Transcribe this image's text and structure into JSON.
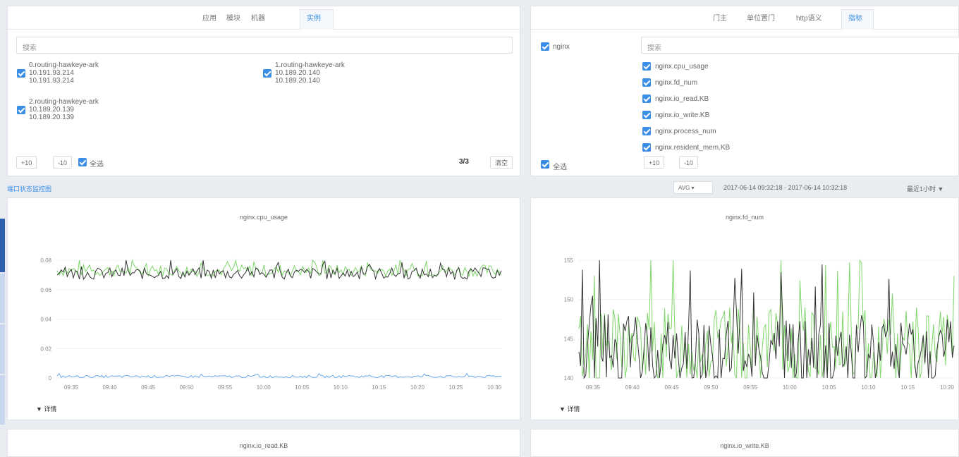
{
  "left_panel": {
    "tabs": [
      "应用",
      "模块",
      "机器",
      "实例"
    ],
    "active_tab": 3,
    "search_placeholder": "搜索",
    "instances": [
      {
        "name": "0.routing-hawkeye-ark",
        "ip1": "10.191.93.214",
        "ip2": "10.191.93.214"
      },
      {
        "name": "1.routing-hawkeye-ark",
        "ip1": "10.189.20.140",
        "ip2": "10.189.20.140"
      },
      {
        "name": "2.routing-hawkeye-ark",
        "ip1": "10.189.20.139",
        "ip2": "10.189.20.139"
      }
    ],
    "plus_label": "+10",
    "minus_label": "-10",
    "select_all_label": "全选",
    "count": "3/3",
    "clear_label": "清空"
  },
  "right_panel": {
    "tabs": [
      "门主",
      "单位置门",
      "http语义",
      "指标"
    ],
    "active_tab": 3,
    "group_label": "nginx",
    "search_placeholder": "搜索",
    "metrics": [
      "nginx.cpu_usage",
      "nginx.fd_num",
      "nginx.io_read.KB",
      "nginx.io_write.KB",
      "nginx.process_num",
      "nginx.resident_mem.KB"
    ],
    "select_all_label": "全选",
    "plus_label": "+10",
    "minus_label": "-10"
  },
  "toolbar": {
    "left_link": "端口状态监控图",
    "agg": "AVG",
    "time_range": "2017-06-14 09:32:18 - 2017-06-14 10:32:18",
    "recent": "最近1小时"
  },
  "detail_label": "▼ 详情",
  "chart_data": [
    {
      "type": "line",
      "title": "nginx.cpu_usage",
      "ylim": [
        0,
        0.08
      ],
      "yticks": [
        "0.08",
        "0.06",
        "0.04",
        "0.02",
        "0"
      ],
      "xticks": [
        "09:35",
        "09:40",
        "09:45",
        "09:50",
        "09:55",
        "10:00",
        "10:05",
        "10:10",
        "10:15",
        "10:20",
        "10:25",
        "10:30"
      ],
      "series": [
        {
          "color": "#7ed66b",
          "approx_value": 0.073,
          "noise": 0.004
        },
        {
          "color": "#333333",
          "approx_value": 0.071,
          "noise": 0.004
        },
        {
          "color": "#6aa9e8",
          "approx_value": 0.001,
          "noise": 0.0008
        }
      ]
    },
    {
      "type": "line",
      "title": "nginx.fd_num",
      "ylim": [
        140,
        155
      ],
      "yticks": [
        "155",
        "150",
        "145",
        "140"
      ],
      "xticks": [
        "09:35",
        "09:40",
        "09:45",
        "09:50",
        "09:55",
        "10:00",
        "10:05",
        "10:10",
        "10:15",
        "10:20"
      ],
      "series": [
        {
          "color": "#7ed66b",
          "approx_value": 144,
          "noise": 5
        },
        {
          "color": "#333333",
          "approx_value": 143,
          "noise": 5
        }
      ]
    },
    {
      "type": "line",
      "title": "nginx.io_read.KB"
    },
    {
      "type": "line",
      "title": "nginx.io_write.KB"
    }
  ]
}
